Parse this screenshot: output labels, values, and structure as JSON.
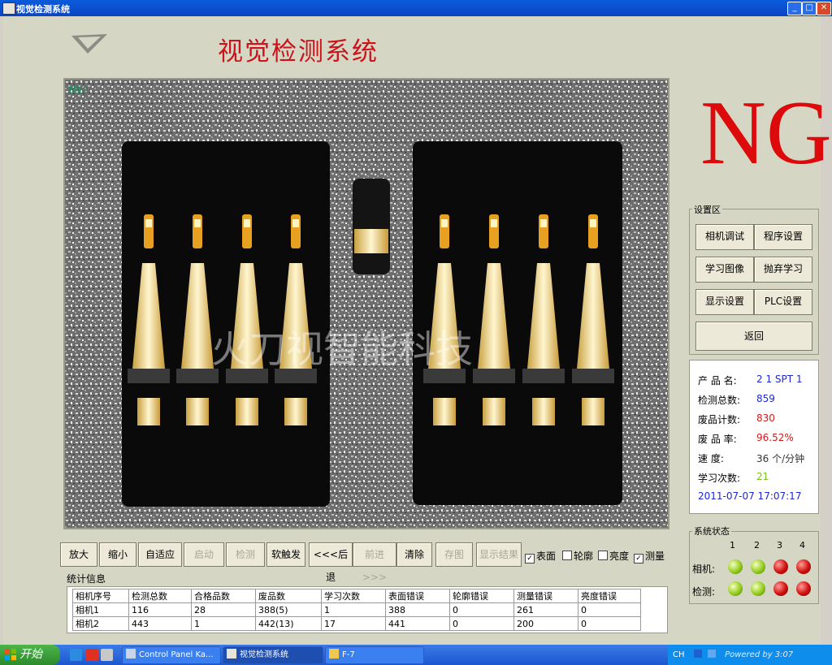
{
  "window": {
    "title": "视觉检测系统"
  },
  "app_title": "视觉检测系统",
  "camera": {
    "tag": "相机1",
    "watermark": "火刀视智能科技"
  },
  "result": "NG",
  "settings": {
    "label": "设置区",
    "buttons": [
      "相机调试",
      "程序设置",
      "学习图像",
      "抛弃学习",
      "显示设置",
      "PLC设置"
    ],
    "return_label": "返回"
  },
  "info": {
    "product": {
      "label": "产 品 名:",
      "value": "2 1 SPT 1"
    },
    "inspect_total": {
      "label": "检测总数:",
      "value": "859"
    },
    "reject_count": {
      "label": "废品计数:",
      "value": "830"
    },
    "reject_rate": {
      "label": "废 品 率:",
      "value": "96.52%"
    },
    "speed": {
      "label": "速    度:",
      "value": "36 个/分钟"
    },
    "learn_count": {
      "label": "学习次数:",
      "value": "21"
    },
    "datetime": "2011-07-07 17:07:17",
    "colors": {
      "normal": "#1c28d8",
      "alert": "#d81818",
      "learn": "#7ac020"
    }
  },
  "toolbar": {
    "buttons": [
      "放大",
      "缩小",
      "自适应",
      "启动",
      "检测",
      "软触发",
      "<<<后退",
      "前进>>>",
      "清除",
      "存图",
      "显示结果"
    ],
    "checks": [
      {
        "label": "表面",
        "checked": true
      },
      {
        "label": "轮廓",
        "checked": false
      },
      {
        "label": "亮度",
        "checked": false
      },
      {
        "label": "测量",
        "checked": true
      }
    ]
  },
  "stats": {
    "label": "统计信息",
    "headers": [
      "相机序号",
      "检测总数",
      "合格品数",
      "废品数",
      "学习次数",
      "表面错误",
      "轮廓错误",
      "测量错误",
      "亮度错误"
    ],
    "rows": [
      [
        "相机1",
        "116",
        "28",
        "388(5)",
        "1",
        "388",
        "0",
        "261",
        "0"
      ],
      [
        "相机2",
        "443",
        "1",
        "442(13)",
        "17",
        "441",
        "0",
        "200",
        "0"
      ]
    ]
  },
  "status": {
    "label": "系统状态",
    "columns": [
      "1",
      "2",
      "3",
      "4"
    ],
    "camera_label": "相机:",
    "detect_label": "检测:",
    "camera_leds": [
      "green",
      "green",
      "red",
      "red"
    ],
    "detect_leds": [
      "green",
      "green",
      "red",
      "red"
    ]
  },
  "taskbar": {
    "start": "开始",
    "tasks": [
      "Control Panel Ka...",
      "视觉检测系统",
      "F-7"
    ],
    "tray": "CH",
    "tray_text": "Powered by 3:07"
  }
}
